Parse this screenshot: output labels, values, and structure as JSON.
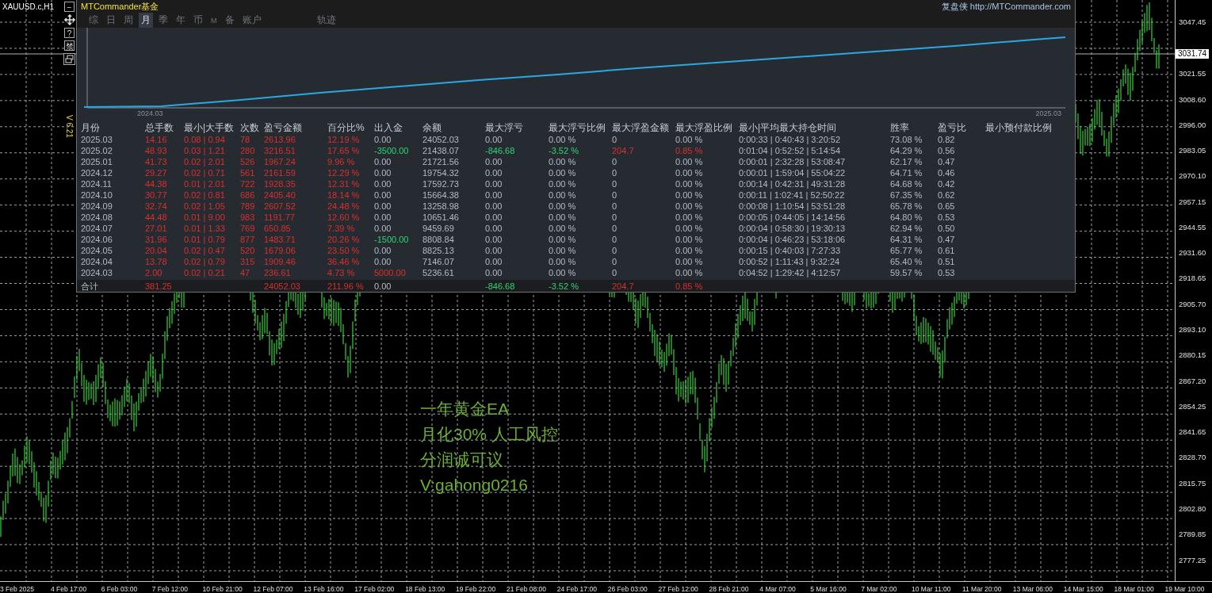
{
  "symbol": "XAUUSD.c,H1",
  "toolbar": {
    "minimize": "−",
    "help": "?",
    "ban": "禁"
  },
  "version": "V 6.21",
  "panel": {
    "title": "MTCommander基金",
    "link": "复盘侠 http://MTCommander.com",
    "tabs": [
      {
        "label": "综",
        "selected": false
      },
      {
        "label": "日",
        "selected": false
      },
      {
        "label": "周",
        "selected": false
      },
      {
        "label": "月",
        "selected": true
      },
      {
        "label": "季",
        "selected": false
      },
      {
        "label": "年",
        "selected": false
      },
      {
        "label": "币",
        "selected": false
      },
      {
        "label": "M",
        "selected": false
      },
      {
        "label": "备",
        "selected": false
      },
      {
        "label": "账户",
        "selected": false
      }
    ],
    "extra_tabs": [
      {
        "label": "轨迹",
        "selected": false
      }
    ],
    "equity_chart": {
      "start_label": "2024.03",
      "end_label": "2025.03"
    },
    "columns": [
      {
        "label": "月份",
        "kind": "neutral"
      },
      {
        "label": "总手数",
        "kind": "up"
      },
      {
        "label": "最小|大手数",
        "kind": "up"
      },
      {
        "label": "次数",
        "kind": "up"
      },
      {
        "label": "盈亏金额",
        "kind": "up"
      },
      {
        "label": "百分比%",
        "kind": "up"
      },
      {
        "label": "出入金",
        "kind": "neutral"
      },
      {
        "label": "余额",
        "kind": "neutral"
      },
      {
        "label": "最大浮亏",
        "kind": "neutral"
      },
      {
        "label": "最大浮亏比例",
        "kind": "neutral"
      },
      {
        "label": "最大浮盈金额",
        "kind": "neutral"
      },
      {
        "label": "最大浮盈比例",
        "kind": "neutral"
      },
      {
        "label": "最小|平均最大持仓时间",
        "kind": "neutral"
      },
      {
        "label": "胜率",
        "kind": "neutral"
      },
      {
        "label": "盈亏比",
        "kind": "neutral"
      },
      {
        "label": "最小预付款比例"
      }
    ],
    "rows": [
      [
        "2025.03",
        "14.16",
        "0.08 | 0.94",
        "78",
        "2613.96",
        "12.19 %",
        "0.00",
        "24052.03",
        "0.00",
        "0.00 %",
        "0",
        "0.00 %",
        "0:00:33 | 0:40:43 | 3:20:52",
        "73.08 %",
        "0.82"
      ],
      [
        "2025.02",
        "48.93",
        "0.03 | 1.21",
        "280",
        "3216.51",
        "17.65 %",
        {
          "text": "-3500.00",
          "kind": "down"
        },
        "21438.07",
        {
          "text": "-846.68",
          "kind": "down"
        },
        {
          "text": "-3.52 %",
          "kind": "down"
        },
        {
          "text": "204.7",
          "kind": "up"
        },
        {
          "text": "0.85 %",
          "kind": "up"
        },
        "0:01:04 | 0:52:52 | 5:14:54",
        "64.29 %",
        "0.56"
      ],
      [
        "2025.01",
        "41.73",
        "0.02 | 2.01",
        "526",
        "1967.24",
        "9.96 %",
        "0.00",
        "21721.56",
        "0.00",
        "0.00 %",
        "0",
        "0.00 %",
        "0:00:01 | 2:32:28 | 53:08:47",
        "62.17 %",
        "0.47"
      ],
      [
        "2024.12",
        "29.27",
        "0.02 | 0.71",
        "561",
        "2161.59",
        "12.29 %",
        "0.00",
        "19754.32",
        "0.00",
        "0.00 %",
        "0",
        "0.00 %",
        "0:00:01 | 1:59:04 | 55:04:22",
        "64.71 %",
        "0.46"
      ],
      [
        "2024.11",
        "44.38",
        "0.01 | 2.01",
        "722",
        "1928.35",
        "12.31 %",
        "0.00",
        "17592.73",
        "0.00",
        "0.00 %",
        "0",
        "0.00 %",
        "0:00:14 | 0:42:31 | 49:31:28",
        "64.68 %",
        "0.42"
      ],
      [
        "2024.10",
        "30.77",
        "0.02 | 0.81",
        "686",
        "2405.40",
        "18.14 %",
        "0.00",
        "15664.38",
        "0.00",
        "0.00 %",
        "0",
        "0.00 %",
        "0:00:11 | 1:02:41 | 52:50:22",
        "67.35 %",
        "0.62"
      ],
      [
        "2024.09",
        "32.74",
        "0.02 | 1.05",
        "789",
        "2607.52",
        "24.48 %",
        "0.00",
        "13258.98",
        "0.00",
        "0.00 %",
        "0",
        "0.00 %",
        "0:00:08 | 1:10:54 | 53:51:28",
        "65.78 %",
        "0.65"
      ],
      [
        "2024.08",
        "44.48",
        "0.01 | 9.00",
        "983",
        "1191.77",
        "12.60 %",
        "0.00",
        "10651.46",
        "0.00",
        "0.00 %",
        "0",
        "0.00 %",
        "0:00:05 | 0:44:05 | 14:14:56",
        "64.80 %",
        "0.53"
      ],
      [
        "2024.07",
        "27.01",
        "0.01 | 1.33",
        "769",
        "650.85",
        "7.39 %",
        "0.00",
        "9459.69",
        "0.00",
        "0.00 %",
        "0",
        "0.00 %",
        "0:00:04 | 0:58:30 | 19:30:13",
        "62.94 %",
        "0.50"
      ],
      [
        "2024.06",
        "31.96",
        "0.01 | 0.79",
        "877",
        "1483.71",
        "20.26 %",
        {
          "text": "-1500.00",
          "kind": "down"
        },
        "8808.84",
        "0.00",
        "0.00 %",
        "0",
        "0.00 %",
        "0:00:04 | 0:46:23 | 53:18:06",
        "64.31 %",
        "0.47"
      ],
      [
        "2024.05",
        "20.04",
        "0.02 | 0.47",
        "520",
        "1679.06",
        "23.50 %",
        "0.00",
        "8825.13",
        "0.00",
        "0.00 %",
        "0",
        "0.00 %",
        "0:00:15 | 0:40:03 | 7:27:33",
        "65.77 %",
        "0.61"
      ],
      [
        "2024.04",
        "13.78",
        "0.02 | 0.79",
        "315",
        "1909.46",
        "36.46 %",
        "0.00",
        "7146.07",
        "0.00",
        "0.00 %",
        "0",
        "0.00 %",
        "0:00:52 | 1:11:43 | 9:32:24",
        "65.40 %",
        "0.51"
      ],
      [
        "2024.03",
        "2.00",
        "0.02 | 0.21",
        "47",
        "236.61",
        "4.73 %",
        {
          "text": "5000.00",
          "kind": "up"
        },
        "5236.61",
        "0.00",
        "0.00 %",
        "0",
        "0.00 %",
        "0:04:52 | 1:29:42 | 4:12:57",
        "59.57 %",
        "0.53"
      ]
    ],
    "total": {
      "label": "合计",
      "total_lots": "381.25",
      "profit": "24052.03",
      "percent": "211.96 %",
      "deposits": "0.00",
      "max_drawdown": {
        "text": "-846.68",
        "kind": "down"
      },
      "max_drawdown_ratio": {
        "text": "-3.52 %",
        "kind": "down"
      },
      "max_float_profit": {
        "text": "204.7",
        "kind": "up"
      },
      "max_float_profit_ratio": {
        "text": "0.85 %",
        "kind": "up"
      }
    }
  },
  "promo": [
    "一年黄金EA",
    "月化30%  人工风控",
    "分润诚可议",
    "V:gahong0216"
  ],
  "price_axis": [
    "3047.45",
    "3021.55",
    "3008.60",
    "2996.00",
    "2983.05",
    "2970.10",
    "2957.15",
    "2944.55",
    "2931.60",
    "2918.65",
    "2905.70",
    "2893.10",
    "2880.15",
    "2867.20",
    "2854.25",
    "2841.65",
    "2828.70",
    "2815.75",
    "2802.80",
    "2789.85",
    "2777.25"
  ],
  "current_price": "3031.74",
  "time_axis": [
    "3 Feb 2025",
    "4 Feb 17:00",
    "6 Feb 03:00",
    "7 Feb 12:00",
    "10 Feb 21:00",
    "12 Feb 07:00",
    "13 Feb 16:00",
    "17 Feb 02:00",
    "18 Feb 13:00",
    "19 Feb 22:00",
    "21 Feb 08:00",
    "24 Feb 17:00",
    "26 Feb 03:00",
    "27 Feb 12:00",
    "28 Feb 21:00",
    "4 Mar 07:00",
    "5 Mar 16:00",
    "7 Mar 02:00",
    "10 Mar 11:00",
    "11 Mar 20:00",
    "13 Mar 06:00",
    "14 Mar 15:00",
    "18 Mar 01:00",
    "19 Mar 10:00"
  ]
}
